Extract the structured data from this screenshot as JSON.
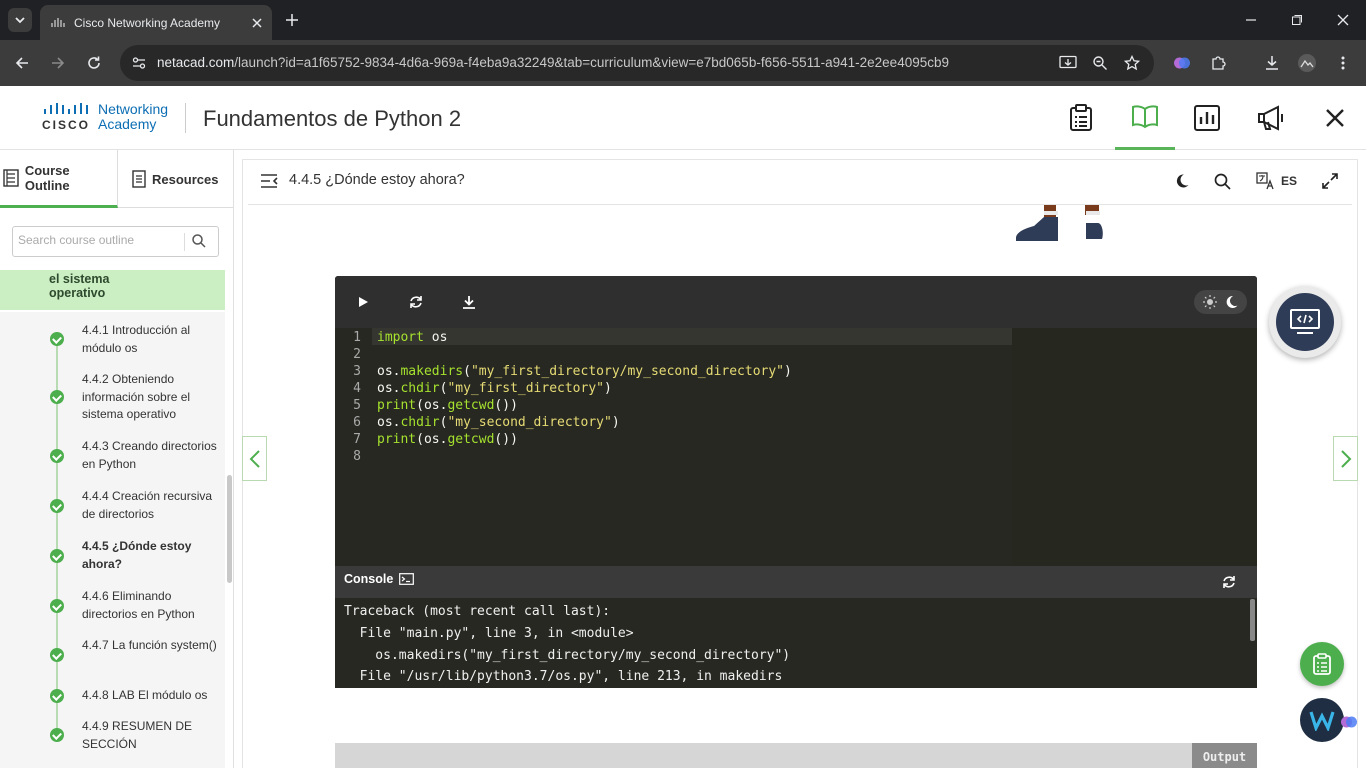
{
  "browser": {
    "tab_title": "Cisco Networking Academy",
    "url_domain": "netacad.com",
    "url_path": "/launch?id=a1f65752-9834-4d6a-969a-f4eba9a32249&tab=curriculum&view=e7bd065b-f656-5511-a941-2e2ee4095cb9"
  },
  "header": {
    "logo_word1": "Networking",
    "logo_word2": "Academy",
    "logo_cisco": "CISCO",
    "course_title": "Fundamentos de Python 2",
    "icons": [
      "clipboard-icon",
      "book-icon",
      "bar-chart-icon",
      "megaphone-icon",
      "close-icon"
    ],
    "active_icon": "book-icon"
  },
  "sidebar": {
    "tab_outline": "Course Outline",
    "tab_resources": "Resources",
    "search_placeholder": "Search course outline",
    "current_section": "el sistema operativo",
    "items": [
      {
        "label": "4.4.1 Introducción al módulo os",
        "completed": true
      },
      {
        "label": "4.4.2 Obteniendo información sobre el sistema operativo",
        "completed": true
      },
      {
        "label": "4.4.3 Creando directorios en Python",
        "completed": true
      },
      {
        "label": "4.4.4 Creación recursiva de directorios",
        "completed": true
      },
      {
        "label": "4.4.5 ¿Dónde estoy ahora?",
        "completed": true,
        "current": true
      },
      {
        "label": "4.4.6 Eliminando directorios en Python",
        "completed": true
      },
      {
        "label": "4.4.7 La función system()",
        "completed": true
      },
      {
        "label": "4.4.8 LAB El módulo os",
        "completed": true
      },
      {
        "label": "4.4.9 RESUMEN DE SECCIÓN",
        "completed": true
      }
    ]
  },
  "content": {
    "page_title": "4.4.5 ¿Dónde estoy ahora?",
    "language": "ES",
    "code_lines": [
      "import os",
      "",
      "os.makedirs(\"my_first_directory/my_second_directory\")",
      "os.chdir(\"my_first_directory\")",
      "print(os.getcwd())",
      "os.chdir(\"my_second_directory\")",
      "print(os.getcwd())",
      ""
    ],
    "console_label": "Console",
    "console_lines": [
      "Traceback (most recent call last):",
      "  File \"main.py\", line 3, in <module>",
      "    os.makedirs(\"my_first_directory/my_second_directory\")",
      "  File \"/usr/lib/python3.7/os.py\", line 213, in makedirs"
    ],
    "output_tab": "Output"
  },
  "colors": {
    "accent_green": "#4cae4c",
    "cisco_blue": "#0d6eb3",
    "editor_bg": "#272822"
  }
}
